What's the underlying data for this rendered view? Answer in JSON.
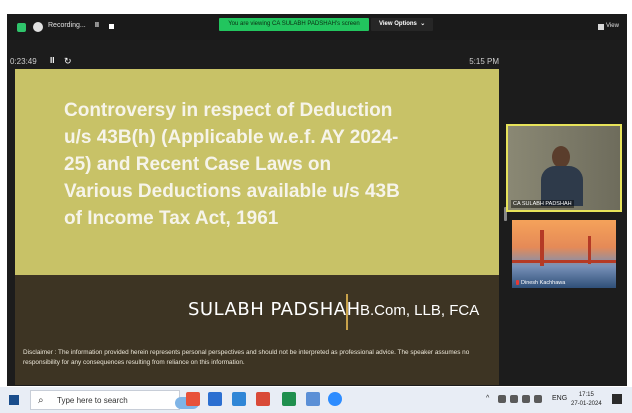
{
  "zoom": {
    "recording_label": "Recording...",
    "pause_symbol": "II",
    "share_banner": "You are viewing CA SULABH PADSHAH's screen",
    "view_options_label": "View Options",
    "view_options_chevron": "⌄",
    "view_label": "View",
    "elapsed_time": "0:23:49",
    "clock_time": "5:15 PM",
    "refresh_symbol": "↻"
  },
  "slide": {
    "title": "Controversy in respect of Deduction u/s 43B(h) (Applicable w.e.f. AY 2024-25) and Recent Case Laws on Various Deductions available u/s 43B of Income Tax Act, 1961",
    "speaker_name": "SULABH PADSHAH",
    "credentials": "B.Com, LLB, FCA",
    "disclaimer": "Disclaimer : The information provided herein represents personal perspectives and should not be interpreted as professional advice. The speaker assumes no responsibility for any consequences resulting from reliance on this information.",
    "top_color": "#c8c267",
    "bottom_color": "#3d3423"
  },
  "participants": [
    {
      "name": "CA SULABH PADSHAH"
    },
    {
      "name": "Dinesh Kachhawa"
    }
  ],
  "taskbar": {
    "search_icon": "⌕",
    "search_placeholder": "Type here to search",
    "tray_chevron": "^",
    "language": "ENG",
    "time": "17:15",
    "date": "27-01-2024"
  },
  "colors": {
    "share_banner": "#22c55e",
    "active_speaker_border": "#e7e35a"
  }
}
